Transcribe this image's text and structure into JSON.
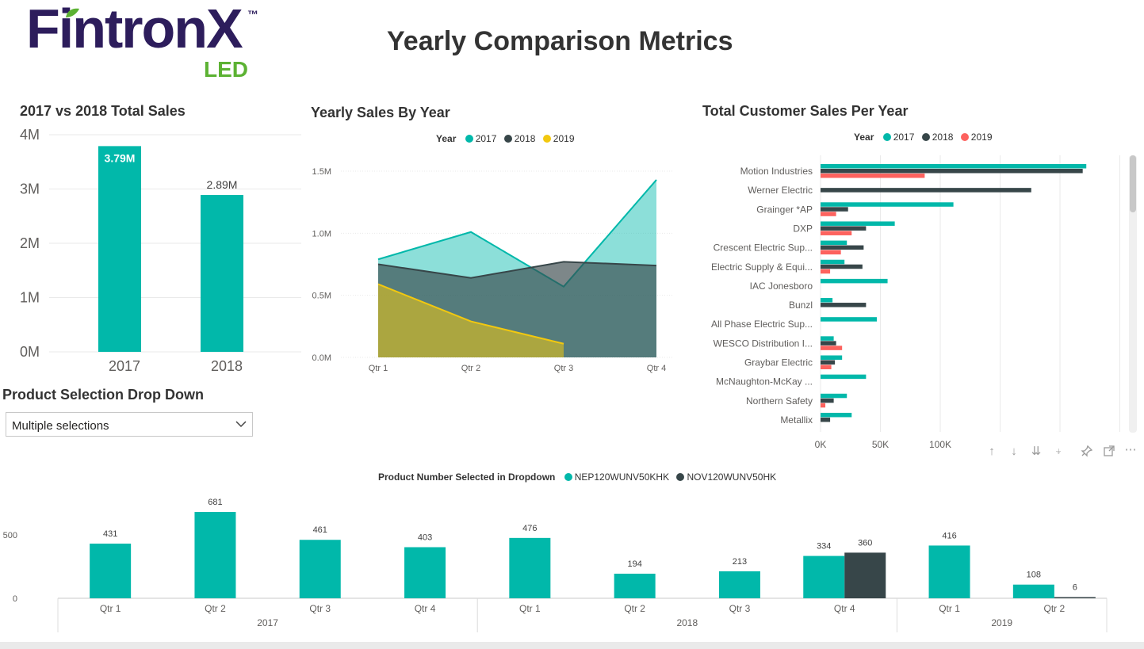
{
  "header": {
    "logo_text": "FintronX",
    "logo_tm": "™",
    "logo_sub": "LED",
    "page_title": "Yearly Comparison Metrics"
  },
  "colors": {
    "teal": "#01b8aa",
    "dark": "#374649",
    "yellow": "#f2c80f",
    "red": "#fd625e",
    "logo_purple": "#2d1d5c",
    "logo_green": "#5cb233"
  },
  "dropdown": {
    "title": "Product Selection Drop Down",
    "value": "Multiple selections"
  },
  "visual_header_icons": [
    "drill-up-icon",
    "drill-down-icon",
    "expand-all-icon",
    "expand-hierarchy-icon",
    "pin-icon",
    "focus-mode-icon",
    "more-options-icon"
  ],
  "chart_data": [
    {
      "type": "bar",
      "title": "2017 vs 2018 Total Sales",
      "categories": [
        "2017",
        "2018"
      ],
      "values": [
        3790000,
        2890000
      ],
      "data_labels": [
        "3.79M",
        "2.89M"
      ],
      "y_ticks": [
        "0M",
        "1M",
        "2M",
        "3M",
        "4M"
      ],
      "ylim": [
        0,
        4000000
      ],
      "grid": true,
      "color": "#01b8aa"
    },
    {
      "type": "area",
      "title": "Yearly Sales By Year",
      "legend_title": "Year",
      "legend_position": "top-center",
      "categories": [
        "Qtr 1",
        "Qtr 2",
        "Qtr 3",
        "Qtr 4"
      ],
      "y_ticks": [
        "0.0M",
        "0.5M",
        "1.0M",
        "1.5M"
      ],
      "ylim": [
        0,
        1500000
      ],
      "grid": true,
      "series": [
        {
          "name": "2017",
          "color": "#01b8aa",
          "values": [
            790000,
            1010000,
            570000,
            1430000
          ]
        },
        {
          "name": "2018",
          "color": "#374649",
          "values": [
            750000,
            640000,
            770000,
            740000
          ]
        },
        {
          "name": "2019",
          "color": "#f2c80f",
          "values": [
            590000,
            290000,
            110000,
            null
          ]
        }
      ]
    },
    {
      "type": "bar",
      "orientation": "horizontal",
      "title": "Total Customer Sales Per Year",
      "legend_title": "Year",
      "legend_position": "top-center",
      "categories": [
        "Motion Industries",
        "Werner Electric",
        "Grainger *AP",
        "DXP",
        "Crescent Electric Sup...",
        "Electric Supply & Equi...",
        "IAC Jonesboro",
        "Bunzl",
        "All Phase Electric Sup...",
        "WESCO Distribution I...",
        "Graybar Electric",
        "McNaughton-McKay ...",
        "Northern Safety",
        "Metallix"
      ],
      "x_ticks": [
        "0K",
        "50K",
        "100K"
      ],
      "xlim": [
        0,
        250000
      ],
      "grid": true,
      "series": [
        {
          "name": "2017",
          "color": "#01b8aa",
          "values": [
            222000,
            0,
            111000,
            62000,
            22000,
            20000,
            56000,
            10000,
            47000,
            11000,
            18000,
            38000,
            22000,
            26000
          ]
        },
        {
          "name": "2018",
          "color": "#374649",
          "values": [
            219000,
            176000,
            23000,
            38000,
            36000,
            35000,
            0,
            38000,
            0,
            13000,
            12000,
            0,
            11000,
            8000
          ]
        },
        {
          "name": "2019",
          "color": "#fd625e",
          "values": [
            87000,
            0,
            13000,
            26000,
            17000,
            8000,
            0,
            0,
            0,
            18000,
            9000,
            0,
            4000,
            0
          ]
        }
      ]
    },
    {
      "type": "bar",
      "title": "",
      "legend_title": "Product Number Selected in Dropdown",
      "legend_position": "top-center",
      "categories": [
        "Qtr 1",
        "Qtr 2",
        "Qtr 3",
        "Qtr 4",
        "Qtr 1",
        "Qtr 2",
        "Qtr 3",
        "Qtr 4",
        "Qtr 1",
        "Qtr 2"
      ],
      "groups": [
        {
          "label": "2017",
          "count": 4
        },
        {
          "label": "2018",
          "count": 4
        },
        {
          "label": "2019",
          "count": 2
        }
      ],
      "y_ticks": [
        "0",
        "500"
      ],
      "ylim": [
        0,
        720
      ],
      "series": [
        {
          "name": "NEP120WUNV50KHK",
          "color": "#01b8aa",
          "values": [
            431,
            681,
            461,
            403,
            476,
            194,
            213,
            334,
            416,
            108
          ]
        },
        {
          "name": "NOV120WUNV50HK",
          "color": "#374649",
          "values": [
            null,
            null,
            null,
            null,
            null,
            null,
            null,
            360,
            null,
            6
          ]
        }
      ]
    }
  ]
}
